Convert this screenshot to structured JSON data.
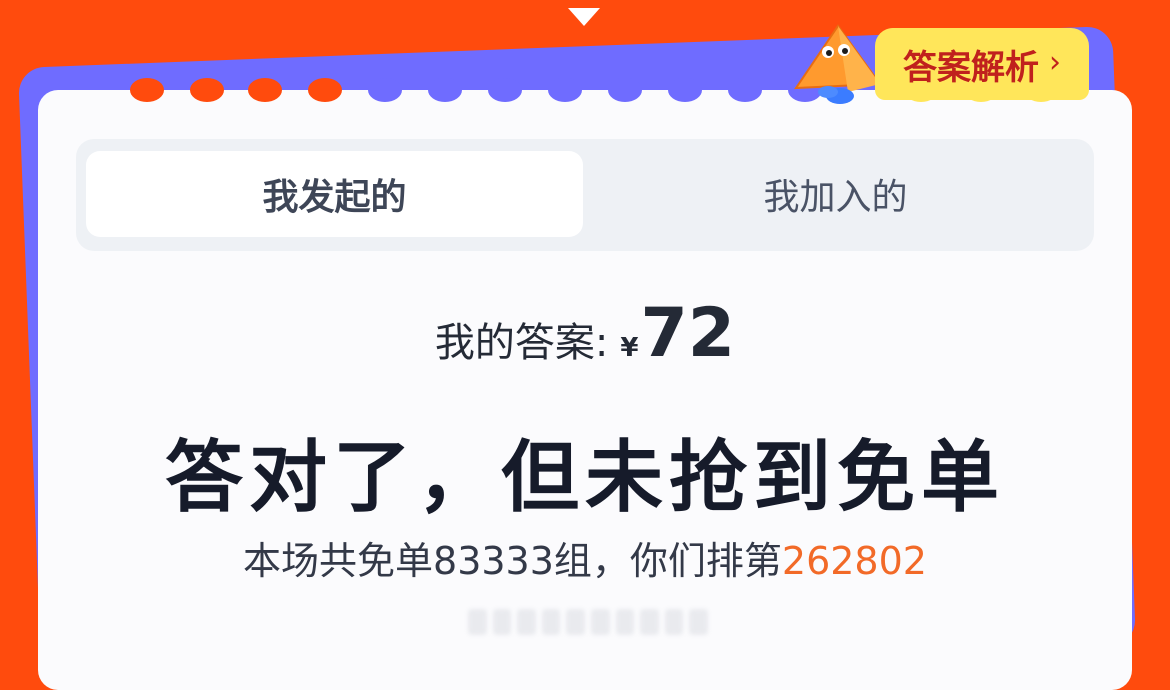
{
  "colors": {
    "background": "#ff4b0d",
    "card_back": "#6f6cff",
    "card": "#fbfbfd",
    "analysis_button_bg": "#ffe65a",
    "analysis_button_text": "#c0211d",
    "highlight": "#f26a28",
    "scallop_blue": "#6f6cff",
    "scallop_yellow": "#ffe65a"
  },
  "header": {
    "analysis_label": "答案解析",
    "analysis_icon": "chevron-right-icon",
    "mascot_icon": "pyramid-mascot-icon"
  },
  "tabs": [
    {
      "label": "我发起的",
      "active": true
    },
    {
      "label": "我加入的",
      "active": false
    }
  ],
  "answer": {
    "label": "我的答案",
    "colon": ":",
    "currency": "¥",
    "value": "72"
  },
  "result": {
    "title": "答对了，但未抢到免单"
  },
  "rank": {
    "text": "本场共免单83333组，你们排第",
    "number": "262802"
  }
}
